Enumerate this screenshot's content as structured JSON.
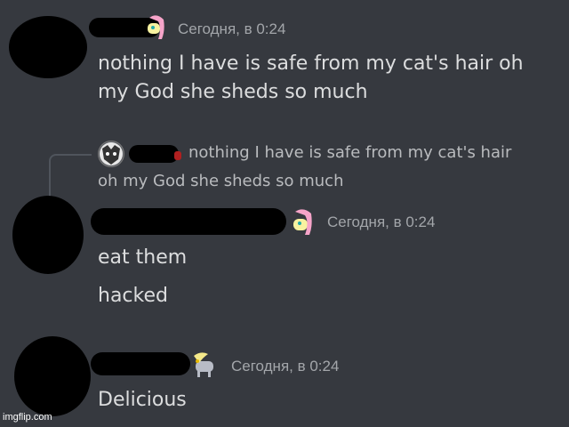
{
  "messages": [
    {
      "timestamp": "Сегодня, в 0:24",
      "lines": [
        "nothing I have is safe from my cat's hair oh",
        "my God she sheds so much"
      ]
    },
    {
      "reply": {
        "lines": [
          "nothing I have is safe from my cat's hair",
          "oh my God she sheds so much"
        ]
      },
      "timestamp": "Сегодня, в 0:24",
      "lines": [
        "eat them",
        "hacked"
      ]
    },
    {
      "timestamp": "Сегодня, в 0:24",
      "lines": [
        "Delicious"
      ]
    }
  ],
  "watermark": "imgflip.com",
  "colors": {
    "background": "#36393f",
    "message_text": "#dcddde",
    "timestamp": "#a3a6aa",
    "reply_text": "#b9bbbe"
  },
  "icons": [
    "fluttershy-pony-icon",
    "derpy-pony-icon"
  ]
}
